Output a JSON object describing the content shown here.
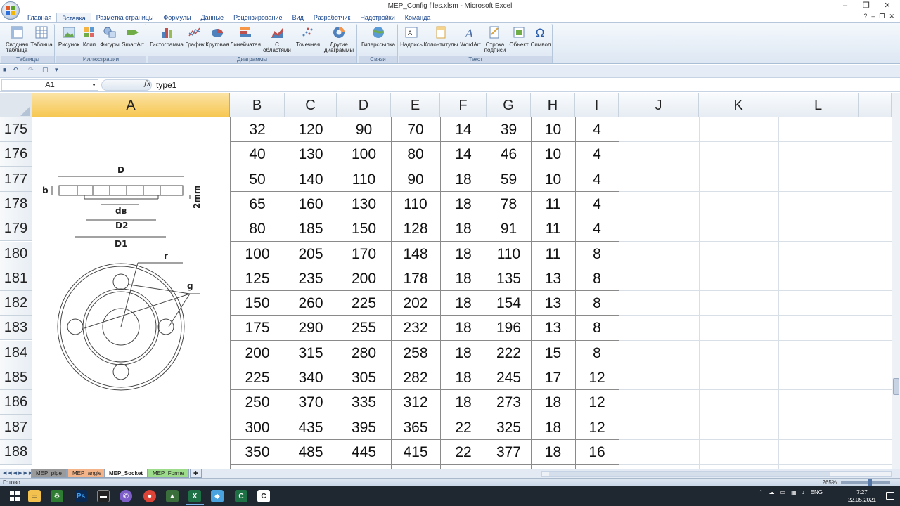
{
  "window": {
    "title": "MEP_Config files.xlsm - Microsoft Excel",
    "controls": [
      "–",
      "❐",
      "✕"
    ]
  },
  "ribbon_tabs": [
    "Главная",
    "Вставка",
    "Разметка страницы",
    "Формулы",
    "Данные",
    "Рецензирование",
    "Вид",
    "Разработчик",
    "Надстройки",
    "Команда"
  ],
  "ribbon": {
    "groups": {
      "tables": "Таблицы",
      "illustrations": "Иллюстрации",
      "charts": "Диаграммы",
      "links": "Связи",
      "text": "Текст"
    },
    "buttons": {
      "pivot": "Сводная таблица",
      "table": "Таблица",
      "picture": "Рисунок",
      "clip": "Клип",
      "shapes": "Фигуры",
      "smartart": "SmartArt",
      "histogram": "Гистограмма",
      "graph": "График",
      "pie": "Круговая",
      "line_bar": "Линейчатая",
      "area": "С областями",
      "scatter": "Точечная",
      "other": "Другие диаграммы",
      "hyperlink": "Гиперссылка",
      "textbox": "Надпись",
      "header": "Колонтитулы",
      "wordart": "WordArt",
      "signature": "Строка подписи",
      "object": "Объект",
      "symbol": "Символ"
    }
  },
  "formula_bar": {
    "name_box": "A1",
    "fx": "fx",
    "value": "type1"
  },
  "columns": [
    "A",
    "B",
    "C",
    "D",
    "E",
    "F",
    "G",
    "H",
    "I",
    "J",
    "K",
    "L"
  ],
  "rows": [
    {
      "n": "175",
      "v": [
        "32",
        "120",
        "90",
        "70",
        "14",
        "39",
        "10",
        "4"
      ]
    },
    {
      "n": "176",
      "v": [
        "40",
        "130",
        "100",
        "80",
        "14",
        "46",
        "10",
        "4"
      ]
    },
    {
      "n": "177",
      "v": [
        "50",
        "140",
        "110",
        "90",
        "18",
        "59",
        "10",
        "4"
      ]
    },
    {
      "n": "178",
      "v": [
        "65",
        "160",
        "130",
        "110",
        "18",
        "78",
        "11",
        "4"
      ]
    },
    {
      "n": "179",
      "v": [
        "80",
        "185",
        "150",
        "128",
        "18",
        "91",
        "11",
        "4"
      ]
    },
    {
      "n": "180",
      "v": [
        "100",
        "205",
        "170",
        "148",
        "18",
        "110",
        "11",
        "8"
      ]
    },
    {
      "n": "181",
      "v": [
        "125",
        "235",
        "200",
        "178",
        "18",
        "135",
        "13",
        "8"
      ]
    },
    {
      "n": "182",
      "v": [
        "150",
        "260",
        "225",
        "202",
        "18",
        "154",
        "13",
        "8"
      ]
    },
    {
      "n": "183",
      "v": [
        "175",
        "290",
        "255",
        "232",
        "18",
        "196",
        "13",
        "8"
      ]
    },
    {
      "n": "184",
      "v": [
        "200",
        "315",
        "280",
        "258",
        "18",
        "222",
        "15",
        "8"
      ]
    },
    {
      "n": "185",
      "v": [
        "225",
        "340",
        "305",
        "282",
        "18",
        "245",
        "17",
        "12"
      ]
    },
    {
      "n": "186",
      "v": [
        "250",
        "370",
        "335",
        "312",
        "18",
        "273",
        "18",
        "12"
      ]
    },
    {
      "n": "187",
      "v": [
        "300",
        "435",
        "395",
        "365",
        "22",
        "325",
        "18",
        "12"
      ]
    },
    {
      "n": "188",
      "v": [
        "350",
        "485",
        "445",
        "415",
        "22",
        "377",
        "18",
        "16"
      ]
    }
  ],
  "drawing_labels": {
    "d": "D",
    "b": "b",
    "mm": "2mm",
    "dv": "dв",
    "d2": "D2",
    "d1": "D1",
    "r": "r",
    "g": "g"
  },
  "sheets": [
    {
      "name": "MEP_pipe",
      "color": "#9a9a9a"
    },
    {
      "name": "MEP_angle",
      "color": "#f3b48a"
    },
    {
      "name": "MEP_Socket",
      "color": "#ffffff"
    },
    {
      "name": "MEP_Forme",
      "color": "#9ddc8a"
    }
  ],
  "status": {
    "ready": "Готово",
    "zoom": "265%"
  },
  "taskbar": {
    "lang": "ENG",
    "time": "7:27",
    "date": "22.05.2021"
  }
}
